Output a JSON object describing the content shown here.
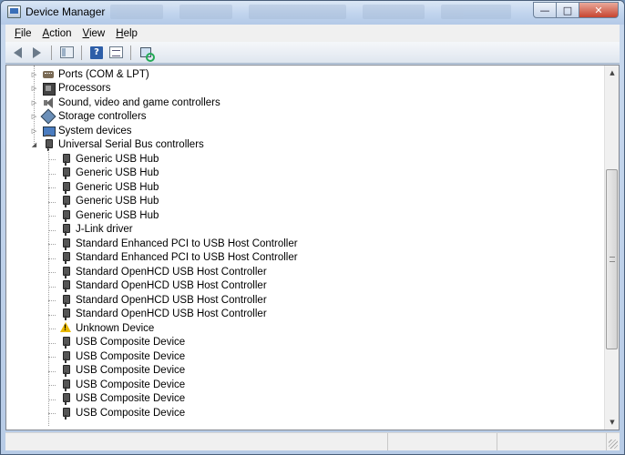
{
  "window": {
    "title": "Device Manager"
  },
  "menu": [
    {
      "key": "F",
      "rest": "ile"
    },
    {
      "key": "A",
      "rest": "ction"
    },
    {
      "key": "V",
      "rest": "iew"
    },
    {
      "key": "H",
      "rest": "elp"
    }
  ],
  "tree": {
    "categories": [
      {
        "label": "Ports (COM & LPT)",
        "icon": "port-icon",
        "expanded": false
      },
      {
        "label": "Processors",
        "icon": "processor-icon",
        "expanded": false
      },
      {
        "label": "Sound, video and game controllers",
        "icon": "speaker-icon",
        "expanded": false
      },
      {
        "label": "Storage controllers",
        "icon": "storage-icon",
        "expanded": false
      },
      {
        "label": "System devices",
        "icon": "system-icon",
        "expanded": false
      },
      {
        "label": "Universal Serial Bus controllers",
        "icon": "usb-icon",
        "expanded": true
      }
    ],
    "usb_devices": [
      {
        "label": "Generic USB Hub",
        "icon": "usb-icon"
      },
      {
        "label": "Generic USB Hub",
        "icon": "usb-icon"
      },
      {
        "label": "Generic USB Hub",
        "icon": "usb-icon"
      },
      {
        "label": "Generic USB Hub",
        "icon": "usb-icon"
      },
      {
        "label": "Generic USB Hub",
        "icon": "usb-icon"
      },
      {
        "label": "J-Link driver",
        "icon": "usb-icon"
      },
      {
        "label": "Standard Enhanced PCI to USB Host Controller",
        "icon": "usb-icon"
      },
      {
        "label": "Standard Enhanced PCI to USB Host Controller",
        "icon": "usb-icon"
      },
      {
        "label": "Standard OpenHCD USB Host Controller",
        "icon": "usb-icon"
      },
      {
        "label": "Standard OpenHCD USB Host Controller",
        "icon": "usb-icon"
      },
      {
        "label": "Standard OpenHCD USB Host Controller",
        "icon": "usb-icon"
      },
      {
        "label": "Standard OpenHCD USB Host Controller",
        "icon": "usb-icon"
      },
      {
        "label": "Unknown Device",
        "icon": "warning-icon"
      },
      {
        "label": "USB Composite Device",
        "icon": "usb-icon"
      },
      {
        "label": "USB Composite Device",
        "icon": "usb-icon"
      },
      {
        "label": "USB Composite Device",
        "icon": "usb-icon"
      },
      {
        "label": "USB Composite Device",
        "icon": "usb-icon"
      },
      {
        "label": "USB Composite Device",
        "icon": "usb-icon"
      },
      {
        "label": "USB Composite Device",
        "icon": "usb-icon"
      }
    ]
  }
}
